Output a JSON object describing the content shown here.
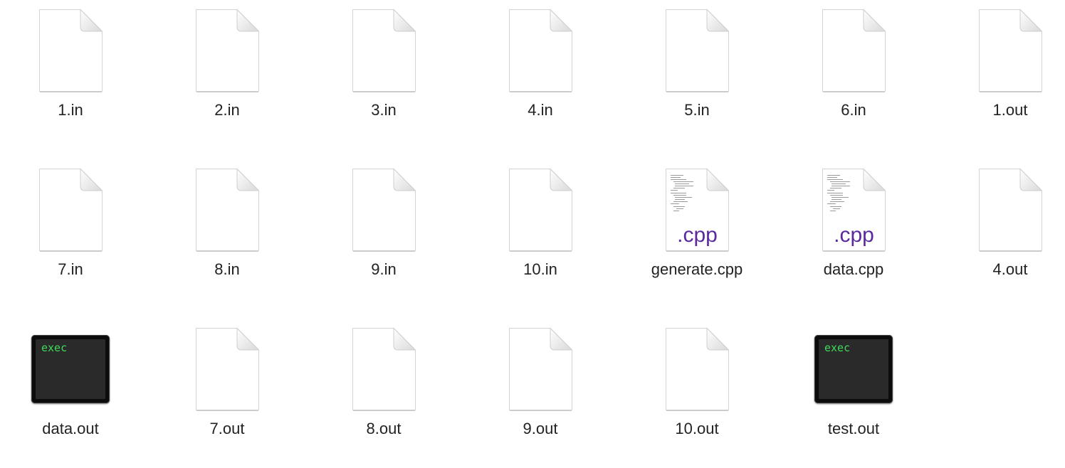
{
  "files": [
    {
      "name": "1.in",
      "kind": "doc",
      "icon": "blank-document-icon"
    },
    {
      "name": "2.in",
      "kind": "doc",
      "icon": "blank-document-icon"
    },
    {
      "name": "3.in",
      "kind": "doc",
      "icon": "blank-document-icon"
    },
    {
      "name": "4.in",
      "kind": "doc",
      "icon": "blank-document-icon"
    },
    {
      "name": "5.in",
      "kind": "doc",
      "icon": "blank-document-icon"
    },
    {
      "name": "6.in",
      "kind": "doc",
      "icon": "blank-document-icon"
    },
    {
      "name": "1.out",
      "kind": "doc",
      "icon": "blank-document-icon"
    },
    {
      "name": "7.in",
      "kind": "doc",
      "icon": "blank-document-icon"
    },
    {
      "name": "8.in",
      "kind": "doc",
      "icon": "blank-document-icon"
    },
    {
      "name": "9.in",
      "kind": "doc",
      "icon": "blank-document-icon"
    },
    {
      "name": "10.in",
      "kind": "doc",
      "icon": "blank-document-icon"
    },
    {
      "name": "generate.cpp",
      "kind": "cpp",
      "icon": "cpp-source-file-icon",
      "badge": ".cpp"
    },
    {
      "name": "data.cpp",
      "kind": "cpp",
      "icon": "cpp-source-file-icon",
      "badge": ".cpp"
    },
    {
      "name": "4.out",
      "kind": "doc",
      "icon": "blank-document-icon"
    },
    {
      "name": "data.out",
      "kind": "exec",
      "icon": "unix-executable-icon",
      "badge": "exec"
    },
    {
      "name": "7.out",
      "kind": "doc",
      "icon": "blank-document-icon"
    },
    {
      "name": "8.out",
      "kind": "doc",
      "icon": "blank-document-icon"
    },
    {
      "name": "9.out",
      "kind": "doc",
      "icon": "blank-document-icon"
    },
    {
      "name": "10.out",
      "kind": "doc",
      "icon": "blank-document-icon"
    },
    {
      "name": "test.out",
      "kind": "exec",
      "icon": "unix-executable-icon",
      "badge": "exec"
    }
  ],
  "colors": {
    "cpp_badge": "#5b2a9c",
    "exec_text": "#3ddc5a",
    "label_text": "#222222"
  }
}
